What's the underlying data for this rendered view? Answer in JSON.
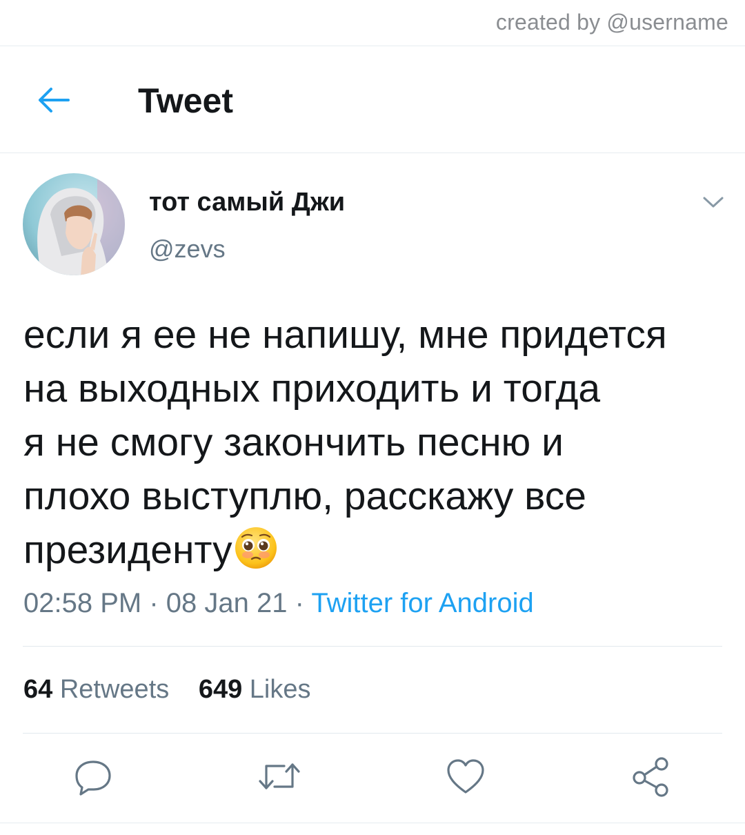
{
  "watermark": {
    "text": "created by @username"
  },
  "header": {
    "back_icon": "arrow-left-icon",
    "title": "Tweet"
  },
  "tweet": {
    "avatar_icon": "profile-photo",
    "display_name": "тот самый Джи",
    "handle": "@zevs",
    "menu_icon": "chevron-down-icon",
    "text": "если я ее не напишу, мне придется\nна выходных приходить и тогда\nя не смогу закончить песню и\nплохо выступлю, расскажу все\nпрезиденту",
    "emoji": "pleading-face-emoji",
    "time": "02:58 PM",
    "date": "08 Jan 21",
    "separator": "·",
    "client": "Twitter for Android"
  },
  "stats": {
    "retweets_count": "64",
    "retweets_label": "Retweets",
    "likes_count": "649",
    "likes_label": "Likes"
  },
  "actions": {
    "reply_icon": "reply-icon",
    "retweet_icon": "retweet-icon",
    "like_icon": "heart-icon",
    "share_icon": "share-icon"
  },
  "colors": {
    "accent": "#1da1f2",
    "text_primary": "#14171a",
    "text_secondary": "#657786",
    "icon_gray": "#657786",
    "divider": "#e1e8ed"
  }
}
